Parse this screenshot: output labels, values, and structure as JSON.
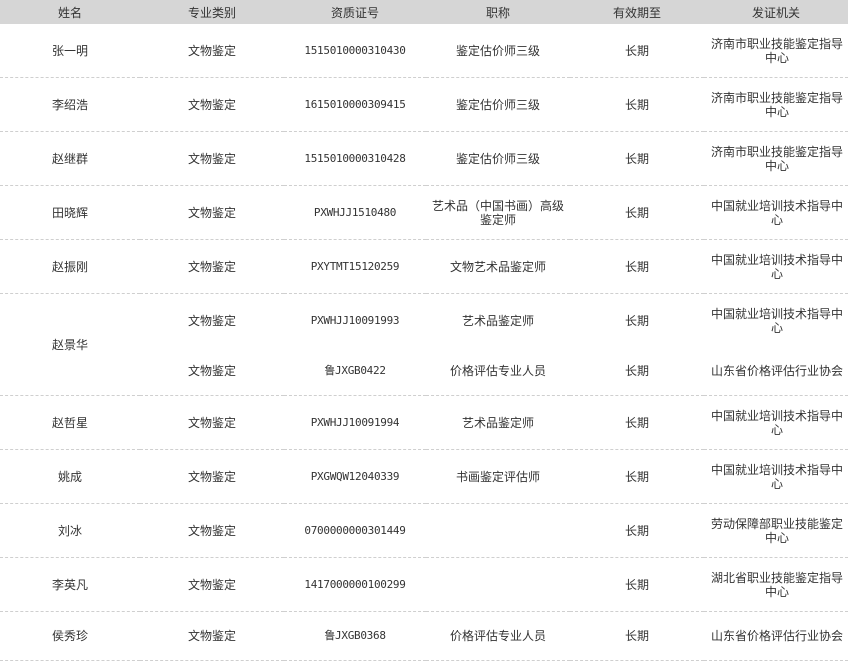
{
  "columns": [
    "姓名",
    "专业类别",
    "资质证号",
    "职称",
    "有效期至",
    "发证机关"
  ],
  "rows": [
    {
      "name": "张一明",
      "category": "文物鉴定",
      "cert": "1515010000310430",
      "title": "鉴定估价师三级",
      "valid": "长期",
      "issuer": "济南市职业技能鉴定指导中心"
    },
    {
      "name": "李绍浩",
      "category": "文物鉴定",
      "cert": "1615010000309415",
      "title": "鉴定估价师三级",
      "valid": "长期",
      "issuer": "济南市职业技能鉴定指导中心"
    },
    {
      "name": "赵继群",
      "category": "文物鉴定",
      "cert": "1515010000310428",
      "title": "鉴定估价师三级",
      "valid": "长期",
      "issuer": "济南市职业技能鉴定指导中心"
    },
    {
      "name": "田晓辉",
      "category": "文物鉴定",
      "cert": "PXWHJJ1510480",
      "title": "艺术品（中国书画）高级鉴定师",
      "valid": "长期",
      "issuer": "中国就业培训技术指导中心"
    },
    {
      "name": "赵振刚",
      "category": "文物鉴定",
      "cert": "PXYTMT15120259",
      "title": "文物艺术品鉴定师",
      "valid": "长期",
      "issuer": "中国就业培训技术指导中心"
    },
    {
      "name": "赵景华",
      "category": "文物鉴定",
      "cert": "PXWHJJ10091993",
      "title": "艺术品鉴定师",
      "valid": "长期",
      "issuer": "中国就业培训技术指导中心",
      "second": {
        "category": "文物鉴定",
        "cert": "鲁JXGB0422",
        "title": "价格评估专业人员",
        "valid": "长期",
        "issuer": "山东省价格评估行业协会"
      }
    },
    {
      "name": "赵哲星",
      "category": "文物鉴定",
      "cert": "PXWHJJ10091994",
      "title": "艺术品鉴定师",
      "valid": "长期",
      "issuer": "中国就业培训技术指导中心"
    },
    {
      "name": "姚成",
      "category": "文物鉴定",
      "cert": "PXGWQW12040339",
      "title": "书画鉴定评估师",
      "valid": "长期",
      "issuer": "中国就业培训技术指导中心"
    },
    {
      "name": "刘冰",
      "category": "文物鉴定",
      "cert": "0700000000301449",
      "title": "",
      "valid": "长期",
      "issuer": "劳动保障部职业技能鉴定中心"
    },
    {
      "name": "李英凡",
      "category": "文物鉴定",
      "cert": "1417000000100299",
      "title": "",
      "valid": "长期",
      "issuer": "湖北省职业技能鉴定指导中心"
    },
    {
      "name": "侯秀珍",
      "category": "文物鉴定",
      "cert": "鲁JXGB0368",
      "title": "价格评估专业人员",
      "valid": "长期",
      "issuer": "山东省价格评估行业协会"
    }
  ]
}
